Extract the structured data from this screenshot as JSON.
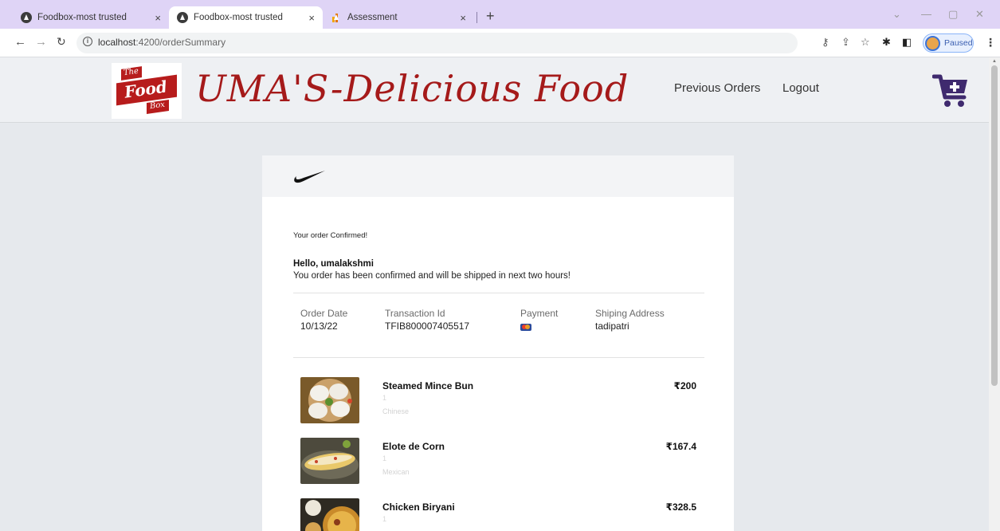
{
  "browser": {
    "tabs": [
      {
        "label": "Foodbox-most trusted",
        "close": "×"
      },
      {
        "label": "Foodbox-most trusted",
        "close": "×"
      },
      {
        "label": "Assessment",
        "close": "×"
      }
    ],
    "new_tab": "+",
    "window_controls": {
      "chevron": "⌄",
      "minimize": "—",
      "maximize": "▢",
      "close": "✕"
    },
    "url_host": "localhost",
    "url_path": ":4200/orderSummary",
    "profile_status": "Paused"
  },
  "header": {
    "logo_lines": [
      "The",
      "Food",
      "Box"
    ],
    "brand_title": "UMA'S-Delicious Food",
    "nav": {
      "previous_orders": "Previous Orders",
      "logout": "Logout"
    }
  },
  "order": {
    "confirmed_line": "Your order Confirmed!",
    "greeting": "Hello, umalakshmi",
    "message": "You order has been confirmed and will be shipped in next two hours!",
    "meta": {
      "order_date_label": "Order Date",
      "order_date": "10/13/22",
      "transaction_label": "Transaction Id",
      "transaction_id": "TFIB800007405517",
      "payment_label": "Payment",
      "address_label": "Shiping Address",
      "address": "tadipatri"
    },
    "items": [
      {
        "name": "Steamed Mince Bun",
        "qty": "1",
        "category": "Chinese",
        "price": "₹200"
      },
      {
        "name": "Elote de Corn",
        "qty": "1",
        "category": "Mexican",
        "price": "₹167.4"
      },
      {
        "name": "Chicken Biryani",
        "qty": "1",
        "category": "",
        "price": "₹328.5"
      }
    ]
  },
  "colors": {
    "brand_red": "#a51a1a",
    "cart_purple": "#3f2a6e",
    "tab_strip": "#dfd4f6"
  }
}
